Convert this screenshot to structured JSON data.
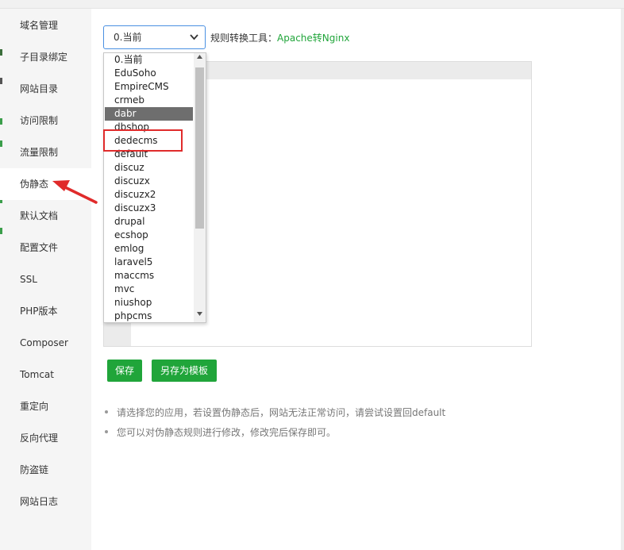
{
  "sidebar": {
    "items": [
      {
        "label": "域名管理"
      },
      {
        "label": "子目录绑定"
      },
      {
        "label": "网站目录"
      },
      {
        "label": "访问限制"
      },
      {
        "label": "流量限制"
      },
      {
        "label": "伪静态"
      },
      {
        "label": "默认文档"
      },
      {
        "label": "配置文件"
      },
      {
        "label": "SSL"
      },
      {
        "label": "PHP版本"
      },
      {
        "label": "Composer"
      },
      {
        "label": "Tomcat"
      },
      {
        "label": "重定向"
      },
      {
        "label": "反向代理"
      },
      {
        "label": "防盗链"
      },
      {
        "label": "网站日志"
      }
    ],
    "active_item": "伪静态"
  },
  "rewrite": {
    "select_value": "0.当前",
    "tool_label": "规则转换工具：",
    "tool_link": "Apache转Nginx",
    "options": [
      {
        "label": "0.当前"
      },
      {
        "label": "EduSoho"
      },
      {
        "label": "EmpireCMS"
      },
      {
        "label": "crmeb"
      },
      {
        "label": "dabr"
      },
      {
        "label": "dbshop"
      },
      {
        "label": "dedecms"
      },
      {
        "label": "default"
      },
      {
        "label": "discuz"
      },
      {
        "label": "discuzx"
      },
      {
        "label": "discuzx2"
      },
      {
        "label": "discuzx3"
      },
      {
        "label": "drupal"
      },
      {
        "label": "ecshop"
      },
      {
        "label": "emlog"
      },
      {
        "label": "laravel5"
      },
      {
        "label": "maccms"
      },
      {
        "label": "mvc"
      },
      {
        "label": "niushop"
      },
      {
        "label": "phpcms"
      }
    ],
    "hovered_option": "dabr",
    "annotated_option": "dedecms"
  },
  "buttons": {
    "save": "保存",
    "save_as_template": "另存为模板"
  },
  "tips": [
    "请选择您的应用，若设置伪静态后，网站无法正常访问，请尝试设置回default",
    "您可以对伪静态规则进行修改，修改完后保存即可。"
  ],
  "colors": {
    "accent_green": "#20a53a",
    "annotation_red": "#e02b2b",
    "select_border": "#4a90e2"
  }
}
